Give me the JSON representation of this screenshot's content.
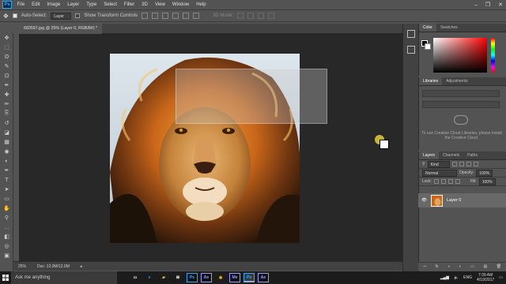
{
  "menubar": {
    "logo": "Ps",
    "items": [
      "File",
      "Edit",
      "Image",
      "Layer",
      "Type",
      "Select",
      "Filter",
      "3D",
      "View",
      "Window",
      "Help"
    ],
    "window_controls": [
      "–",
      "❐",
      "✕"
    ]
  },
  "options": {
    "auto_select_label": "Auto-Select:",
    "auto_select_value": "Layer",
    "show_transform_label": "Show Transform Controls",
    "mode_3d_label": "3D Mode:"
  },
  "document": {
    "tab_title": "683597.jpg @ 25% (Layer 0, RGB/8#) *",
    "zoom": "25%",
    "doc_info": "Doc: 12.0M/12.0M"
  },
  "toolbar": {
    "icons": [
      "move-icon",
      "marquee-icon",
      "lasso-icon",
      "quick-select-icon",
      "crop-icon",
      "eyedropper-icon",
      "healing-icon",
      "brush-icon",
      "clone-stamp-icon",
      "history-brush-icon",
      "eraser-icon",
      "gradient-icon",
      "blur-icon",
      "dodge-icon",
      "pen-icon",
      "type-icon",
      "path-select-icon",
      "rectangle-icon",
      "hand-icon",
      "zoom-icon",
      "more-icon",
      "fg-bg-icon",
      "quick-mask-icon",
      "screen-mode-icon"
    ],
    "glyphs": [
      "✥",
      "⬚",
      "ʘ",
      "✎",
      "⊡",
      "✒",
      "✚",
      "✏",
      "⎘",
      "↺",
      "◪",
      "▦",
      "◉",
      "◐",
      "✒",
      "T",
      "➤",
      "▭",
      "✋",
      "⚲",
      "…",
      "◧",
      "◎",
      "▣"
    ]
  },
  "color_panel": {
    "tabs": [
      "Color",
      "Swatches"
    ],
    "fg_color": "#000000",
    "bg_color": "#ffffff"
  },
  "libraries_panel": {
    "tabs": [
      "Libraries",
      "Adjustments"
    ],
    "message": "To use Creative Cloud Libraries, please install the Creative Cloud."
  },
  "layers_panel": {
    "tabs": [
      "Layers",
      "Channels",
      "Paths"
    ],
    "filter_label": "Kind",
    "blend_mode": "Normal",
    "opacity_label": "Opacity:",
    "opacity_value": "100%",
    "lock_label": "Lock:",
    "fill_label": "Fill:",
    "fill_value": "100%",
    "layers": [
      {
        "name": "Layer 0"
      }
    ],
    "footer_icons": [
      "⊸",
      "fx",
      "◑",
      "◐",
      "▭",
      "▤",
      "🗑"
    ]
  },
  "taskbar": {
    "search_placeholder": "Ask me anything",
    "apps": [
      {
        "name": "task-view-icon",
        "glyph": "▭",
        "color": "#ffffff"
      },
      {
        "name": "edge-icon",
        "glyph": "e",
        "color": "#3a8fe0"
      },
      {
        "name": "file-explorer-icon",
        "glyph": "▰",
        "color": "#f0c040"
      },
      {
        "name": "store-icon",
        "glyph": "⊞",
        "color": "#ffffff"
      },
      {
        "name": "photoshop-icon",
        "glyph": "Ps",
        "color": "#31a8ff"
      },
      {
        "name": "after-effects-icon",
        "glyph": "Ae",
        "color": "#9999ff"
      },
      {
        "name": "chrome-icon",
        "glyph": "◉",
        "color": "#e8b200"
      },
      {
        "name": "media-encoder-icon",
        "glyph": "Me",
        "color": "#9999ff"
      },
      {
        "name": "photoshop-active-icon",
        "glyph": "Ps",
        "color": "#31a8ff"
      },
      {
        "name": "after-effects-2-icon",
        "glyph": "Ae",
        "color": "#9999ff"
      }
    ],
    "language": "ENG",
    "time": "7:39 AM",
    "date": "4/19/2017"
  }
}
